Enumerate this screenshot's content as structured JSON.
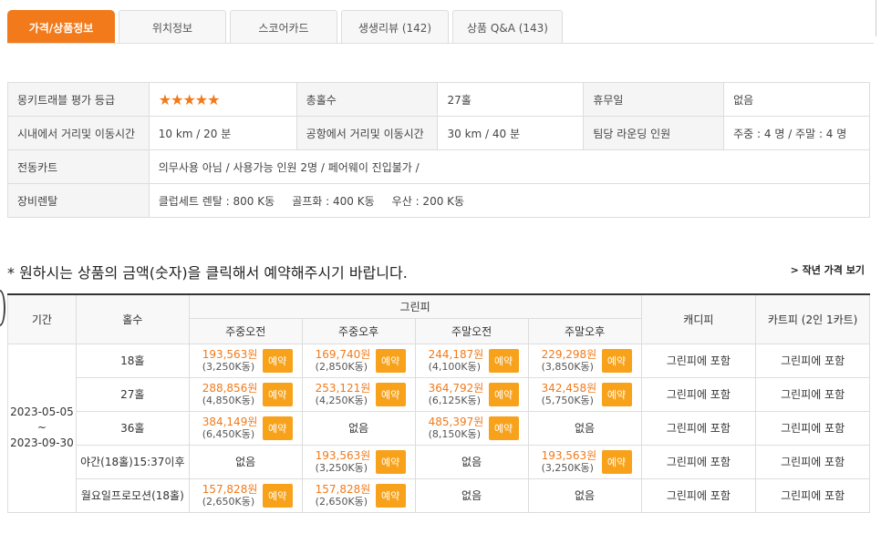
{
  "tabs": [
    {
      "label": "가격/상품정보",
      "active": true
    },
    {
      "label": "위치정보"
    },
    {
      "label": "스코어카드"
    },
    {
      "label": "생생리뷰 (142)"
    },
    {
      "label": "상품 Q&A (143)"
    }
  ],
  "info": {
    "rating_label": "몽키트래블 평가 등급",
    "rating_stars": "★★★★★",
    "holes_label": "총홀수",
    "holes_value": "27홀",
    "closed_label": "휴무일",
    "closed_value": "없음",
    "city_label": "시내에서 거리및 이동시간",
    "city_value": "10 km / 20 분",
    "airport_label": "공항에서 거리및 이동시간",
    "airport_value": "30 km / 40 분",
    "teams_label": "팀당 라운딩 인원",
    "teams_value": "주중 : 4 명 / 주말 : 4 명",
    "cart_label": "전동카트",
    "cart_value": "의무사용 아님 / 사용가능 인원 2명 / 페어웨이 진입불가 /",
    "rental_label": "장비렌탈",
    "rental_value": "클럽세트 렌탈 : 800 K동     골프화 : 400 K동     우산 : 200 K동"
  },
  "notice": "* 원하시는 상품의 금액(숫자)을 클릭해서 예약해주시기 바랍니다.",
  "prev_year_link": "> 작년 가격 보기",
  "price_table": {
    "headers": {
      "period": "기간",
      "holes": "홀수",
      "greenfee": "그린피",
      "caddie": "캐디피",
      "cart": "카트피 (2인 1카트)",
      "weekday_am": "주중오전",
      "weekday_pm": "주중오후",
      "weekend_am": "주말오전",
      "weekend_pm": "주말오후"
    },
    "period_start": "2023-05-05",
    "period_sep": "~",
    "period_end": "2023-09-30",
    "book_label": "예약",
    "none_label": "없음",
    "included_label": "그린피에 포함",
    "rows": [
      {
        "holes": "18홀",
        "wd_am": {
          "amt": "193,563원",
          "krw": "(3,250K동)"
        },
        "wd_pm": {
          "amt": "169,740원",
          "krw": "(2,850K동)"
        },
        "we_am": {
          "amt": "244,187원",
          "krw": "(4,100K동)"
        },
        "we_pm": {
          "amt": "229,298원",
          "krw": "(3,850K동)"
        }
      },
      {
        "holes": "27홀",
        "wd_am": {
          "amt": "288,856원",
          "krw": "(4,850K동)"
        },
        "wd_pm": {
          "amt": "253,121원",
          "krw": "(4,250K동)"
        },
        "we_am": {
          "amt": "364,792원",
          "krw": "(6,125K동)"
        },
        "we_pm": {
          "amt": "342,458원",
          "krw": "(5,750K동)"
        }
      },
      {
        "holes": "36홀",
        "wd_am": {
          "amt": "384,149원",
          "krw": "(6,450K동)"
        },
        "we_am": {
          "amt": "485,397원",
          "krw": "(8,150K동)"
        }
      },
      {
        "holes": "야간(18홀)15:37이후",
        "wd_pm": {
          "amt": "193,563원",
          "krw": "(3,250K동)"
        },
        "we_pm": {
          "amt": "193,563원",
          "krw": "(3,250K동)"
        }
      },
      {
        "holes": "월요일프로모션(18홀)",
        "wd_am": {
          "amt": "157,828원",
          "krw": "(2,650K동)"
        },
        "wd_pm": {
          "amt": "157,828원",
          "krw": "(2,650K동)"
        }
      }
    ]
  },
  "colors": {
    "accent": "#f27a1a",
    "button": "#f7a21a"
  }
}
